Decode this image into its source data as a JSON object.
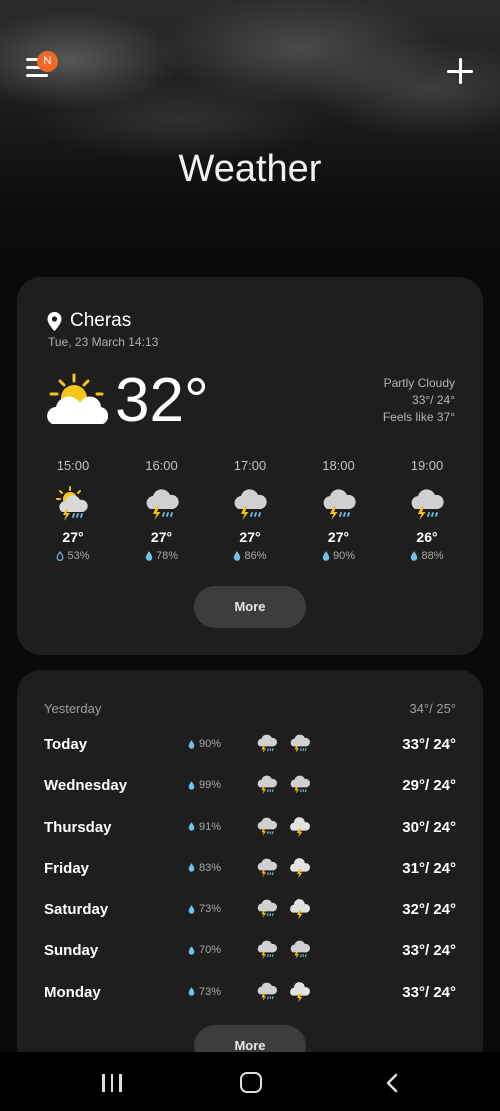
{
  "header": {
    "title": "Weather",
    "menu_badge": "N",
    "menu_icon": "hamburger-menu-icon",
    "add_icon": "plus-icon"
  },
  "current": {
    "location": "Cheras",
    "datetime": "Tue, 23 March 14:13",
    "temperature": "32°",
    "condition": "Partly Cloudy",
    "high_low": "33°/ 24°",
    "feels_like": "Feels like 37°",
    "icon": "partly-cloudy-icon"
  },
  "hourly": [
    {
      "time": "15:00",
      "temp": "27°",
      "rain": "53%",
      "icon": "sun-thunder-rain-icon"
    },
    {
      "time": "16:00",
      "temp": "27°",
      "rain": "78%",
      "icon": "thunder-rain-icon"
    },
    {
      "time": "17:00",
      "temp": "27°",
      "rain": "86%",
      "icon": "thunder-rain-icon"
    },
    {
      "time": "18:00",
      "temp": "27°",
      "rain": "90%",
      "icon": "thunder-rain-icon"
    },
    {
      "time": "19:00",
      "temp": "26°",
      "rain": "88%",
      "icon": "thunder-rain-icon"
    }
  ],
  "hourly_more": "More",
  "yesterday": {
    "label": "Yesterday",
    "temps": "34°/ 25°"
  },
  "daily": [
    {
      "day": "Today",
      "rain": "90%",
      "temps": "33°/ 24°"
    },
    {
      "day": "Wednesday",
      "rain": "99%",
      "temps": "29°/ 24°"
    },
    {
      "day": "Thursday",
      "rain": "91%",
      "temps": "30°/ 24°"
    },
    {
      "day": "Friday",
      "rain": "83%",
      "temps": "31°/ 24°"
    },
    {
      "day": "Saturday",
      "rain": "73%",
      "temps": "32°/ 24°"
    },
    {
      "day": "Sunday",
      "rain": "70%",
      "temps": "33°/ 24°"
    },
    {
      "day": "Monday",
      "rain": "73%",
      "temps": "33°/ 24°"
    }
  ],
  "daily_more": "More",
  "colors": {
    "accent_badge": "#f0682a",
    "sun": "#f5c518",
    "bolt": "#f2c20f",
    "rain": "#6fc3e8",
    "card": "#1e1e1e"
  }
}
